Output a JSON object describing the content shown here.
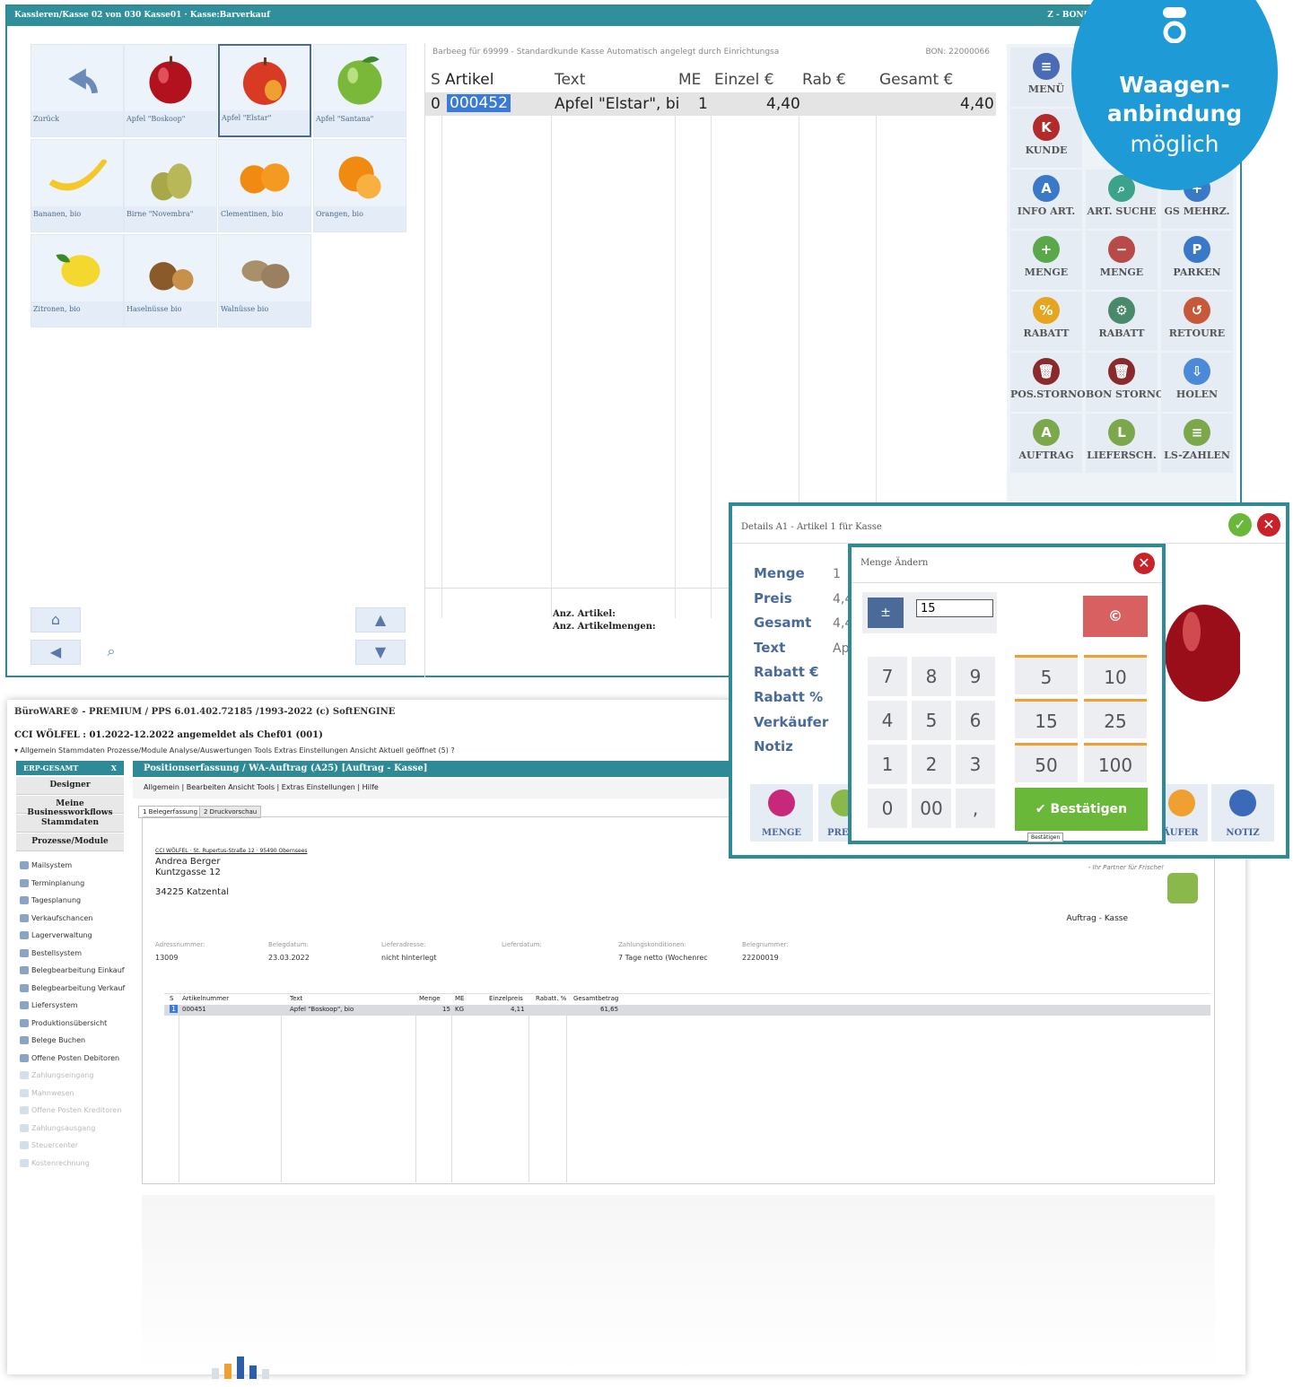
{
  "pos": {
    "title": "Kassieren/Kasse 02 von 030 Kasse01 · Kasse:Barverkauf",
    "title_right": "Z - BON[23] vom 2",
    "tiles": [
      {
        "name": "Zurück",
        "icon": "back-arrow-icon"
      },
      {
        "name": "Apfel \"Boskoop\"",
        "icon": "apple-red-icon"
      },
      {
        "name": "Apfel \"Elstar\"",
        "icon": "apple-red-yellow-icon"
      },
      {
        "name": "Apfel \"Santana\"",
        "icon": "apple-green-icon"
      },
      {
        "name": "Bananen, bio",
        "icon": "banana-icon"
      },
      {
        "name": "Birne \"Novembra\"",
        "icon": "pear-icon"
      },
      {
        "name": "Clementinen, bio",
        "icon": "clementine-icon"
      },
      {
        "name": "Orangen, bio",
        "icon": "orange-icon"
      },
      {
        "name": "Zitronen, bio",
        "icon": "lemon-icon"
      },
      {
        "name": "Haselnüsse bio",
        "icon": "hazelnut-icon"
      },
      {
        "name": "Walnüsse bio",
        "icon": "walnut-icon"
      }
    ],
    "receipt_info": "Barbeeg für 69999 - Standardkunde Kasse Automatisch angelegt durch Einrichtungsa",
    "bon": "BON: 22000066",
    "columns": [
      "S",
      "Artikel",
      "Text",
      "ME",
      "Einzel €",
      "Rab €",
      "Gesamt €"
    ],
    "row": {
      "s": "0",
      "artikel": "000452",
      "text": "Apfel \"Elstar\", bi",
      "me": "1",
      "einzel": "4,40",
      "gesamt": "4,40"
    },
    "summary_1": "Anz. Artikel:",
    "summary_2": "Anz. Artikelmengen:",
    "buttons": [
      {
        "label": "MENÜ",
        "color": "#4a6bb5",
        "glyph": "≡"
      },
      {
        "label": "KUNDE",
        "color": "#b22a2a",
        "glyph": "K"
      },
      {
        "label": "INFO ART.",
        "color": "#3a79c8",
        "glyph": "A"
      },
      {
        "label": "ART. SUCHE",
        "color": "#3aa38a",
        "glyph": "⌕"
      },
      {
        "label": "GS MEHRZ.",
        "color": "#3a79c8",
        "glyph": "+"
      },
      {
        "label": "MENGE",
        "color": "#5aa84a",
        "glyph": "+"
      },
      {
        "label": "MENGE",
        "color": "#b84a4a",
        "glyph": "−"
      },
      {
        "label": "PARKEN",
        "color": "#3a79c8",
        "glyph": "P"
      },
      {
        "label": "RABATT",
        "color": "#e6a520",
        "glyph": "%"
      },
      {
        "label": "RABATT",
        "color": "#4a8a6a",
        "glyph": "⚙"
      },
      {
        "label": "RETOURE",
        "color": "#c8583a",
        "glyph": "↺"
      },
      {
        "label": "POS.STORNO",
        "color": "#8a2a2a",
        "glyph": "🗑"
      },
      {
        "label": "BON STORNO",
        "color": "#8a2a2a",
        "glyph": "🗑"
      },
      {
        "label": "HOLEN",
        "color": "#4a8ad8",
        "glyph": "⇩"
      },
      {
        "label": "AUFTRAG",
        "color": "#7aa84a",
        "glyph": "A"
      },
      {
        "label": "LIEFERSCH.",
        "color": "#7aa84a",
        "glyph": "L"
      },
      {
        "label": "LS-ZAHLEN",
        "color": "#7aa84a",
        "glyph": "≡"
      }
    ]
  },
  "badge": {
    "line1": "Waagen-",
    "line2": "anbindung",
    "line3": "möglich"
  },
  "erp": {
    "title": "BüroWARE® - PREMIUM / PPS 6.01.402.72185 /1993-2022 (c) SoftENGINE",
    "sub": "CCI WÖLFEL : 01.2022-12.2022 angemeldet als Chef01 (001)",
    "menu": "▾ Allgemein  Stammdaten  Prozesse/Module  Analyse/Auswertungen  Tools  Extras  Einstellungen  Ansicht  Aktuell geöffnet (5)  ?",
    "side_head": "ERP-GESAMT",
    "side_buttons": [
      "Designer",
      "Meine Businessworkflows",
      "Stammdaten",
      "Prozesse/Module"
    ],
    "side_items": [
      "Mailsystem",
      "Terminplanung",
      "Tagesplanung",
      "Verkaufschancen",
      "Lagerverwaltung",
      "Bestellsystem",
      "Belegbearbeitung Einkauf",
      "Belegbearbeitung Verkauf",
      "Liefersystem",
      "Produktionsübersicht",
      "Belege Buchen",
      "Offene Posten Debitoren",
      "Zahlungseingang",
      "Mahnwesen",
      "Offene Posten Kreditoren",
      "Zahlungsausgang",
      "Steuercenter",
      "Kostenrechnung"
    ],
    "pos_head": "Positionserfassung / WA-Auftrag (A25) [Auftrag - Kasse]",
    "toolbar": "Allgemein  |  Bearbeiten  Ansicht  Tools  |  Extras  Einstellungen  |  Hilfe",
    "tab1": "1 Belegerfassung",
    "tab2": "2 Druckvorschau",
    "sender": "CCI WÖLFEL · St. Rupertus-Straße 12 · 95490 Obernsees",
    "addr1": "Andrea Berger",
    "addr2": "Kuntzgasse 12",
    "addr3": "34225 Katzental",
    "slogan": "- Ihr Partner für Frische!",
    "doctype": "Auftrag - Kasse",
    "fields": [
      {
        "label": "Adressnummer:",
        "value": "13009"
      },
      {
        "label": "Belegdatum:",
        "value": "23.03.2022"
      },
      {
        "label": "Lieferadresse:",
        "value": "nicht hinterlegt"
      },
      {
        "label": "Lieferdatum:",
        "value": ""
      },
      {
        "label": "Zahlungskonditionen:",
        "value": "7 Tage netto (Wochenrec"
      },
      {
        "label": "Belegnummer:",
        "value": "22200019"
      }
    ],
    "table_headers": [
      "S",
      "Artikelnummer",
      "Text",
      "Menge",
      "ME",
      "Einzelpreis",
      "Rabatt. %",
      "Gesamtbetrag"
    ],
    "table_row": {
      "s": "1",
      "nr": "000451",
      "text": "Apfel \"Boskoop\", bio",
      "menge": "15",
      "me": "KG",
      "preis": "4,11",
      "gesamt": "61,65"
    }
  },
  "details": {
    "title": "Details A1 - Artikel 1 für Kasse",
    "labels": [
      "Menge",
      "Preis",
      "Gesamt",
      "Text",
      "Rabatt €",
      "Rabatt %",
      "Verkäufer",
      "Notiz"
    ],
    "values": [
      "1",
      "4,4",
      "4,4",
      "Ap"
    ],
    "bottom": [
      "MENGE",
      "PRE",
      "ÄUFER",
      "NOTIZ"
    ]
  },
  "qty": {
    "title": "Menge Ändern",
    "value": "15",
    "keys": [
      "7",
      "8",
      "9",
      "4",
      "5",
      "6",
      "1",
      "2",
      "3",
      "0",
      "00",
      ","
    ],
    "presets": [
      "5",
      "10",
      "15",
      "25",
      "50",
      "100"
    ],
    "confirm": "Bestätigen",
    "tooltip": "Bestätigen"
  }
}
